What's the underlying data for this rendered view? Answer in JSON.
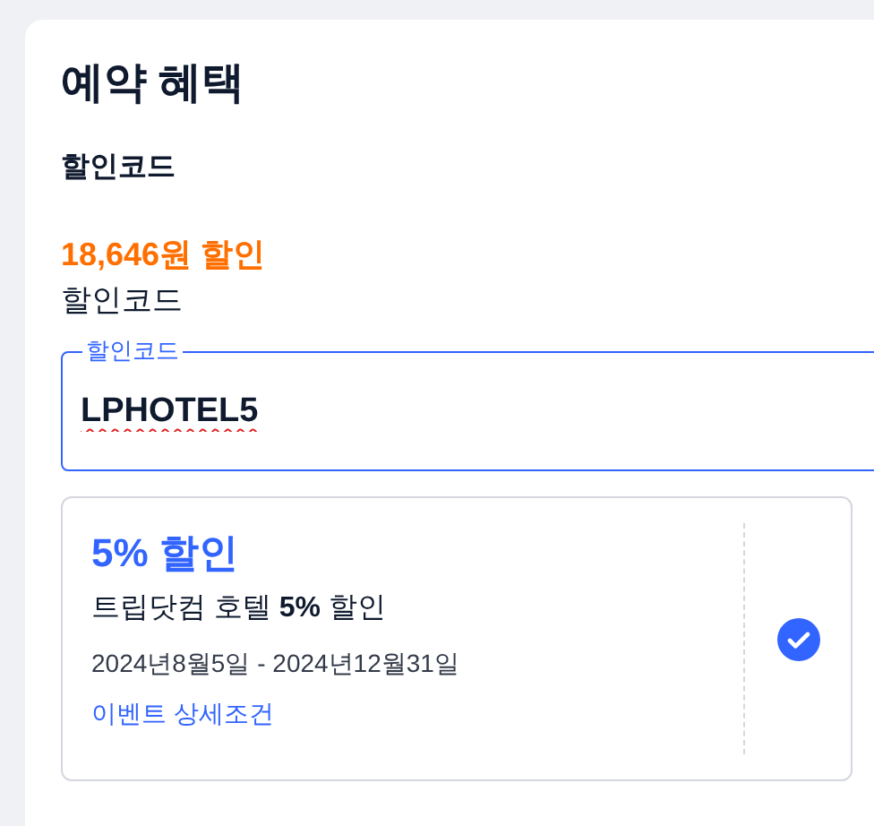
{
  "section_title": "예약 혜택",
  "code_heading": "할인코드",
  "discount_amount": "18,646원 할인",
  "code_label": "할인코드",
  "code_field": {
    "label": "할인코드",
    "value": "LPHOTEL5"
  },
  "coupons": [
    {
      "title": "5% 할인",
      "description": "트립닷컴 호텔 **5%** 할인",
      "period": "2024년8월5일 - 2024년12월31일",
      "link": "이벤트 상세조건",
      "selected": true
    }
  ]
}
